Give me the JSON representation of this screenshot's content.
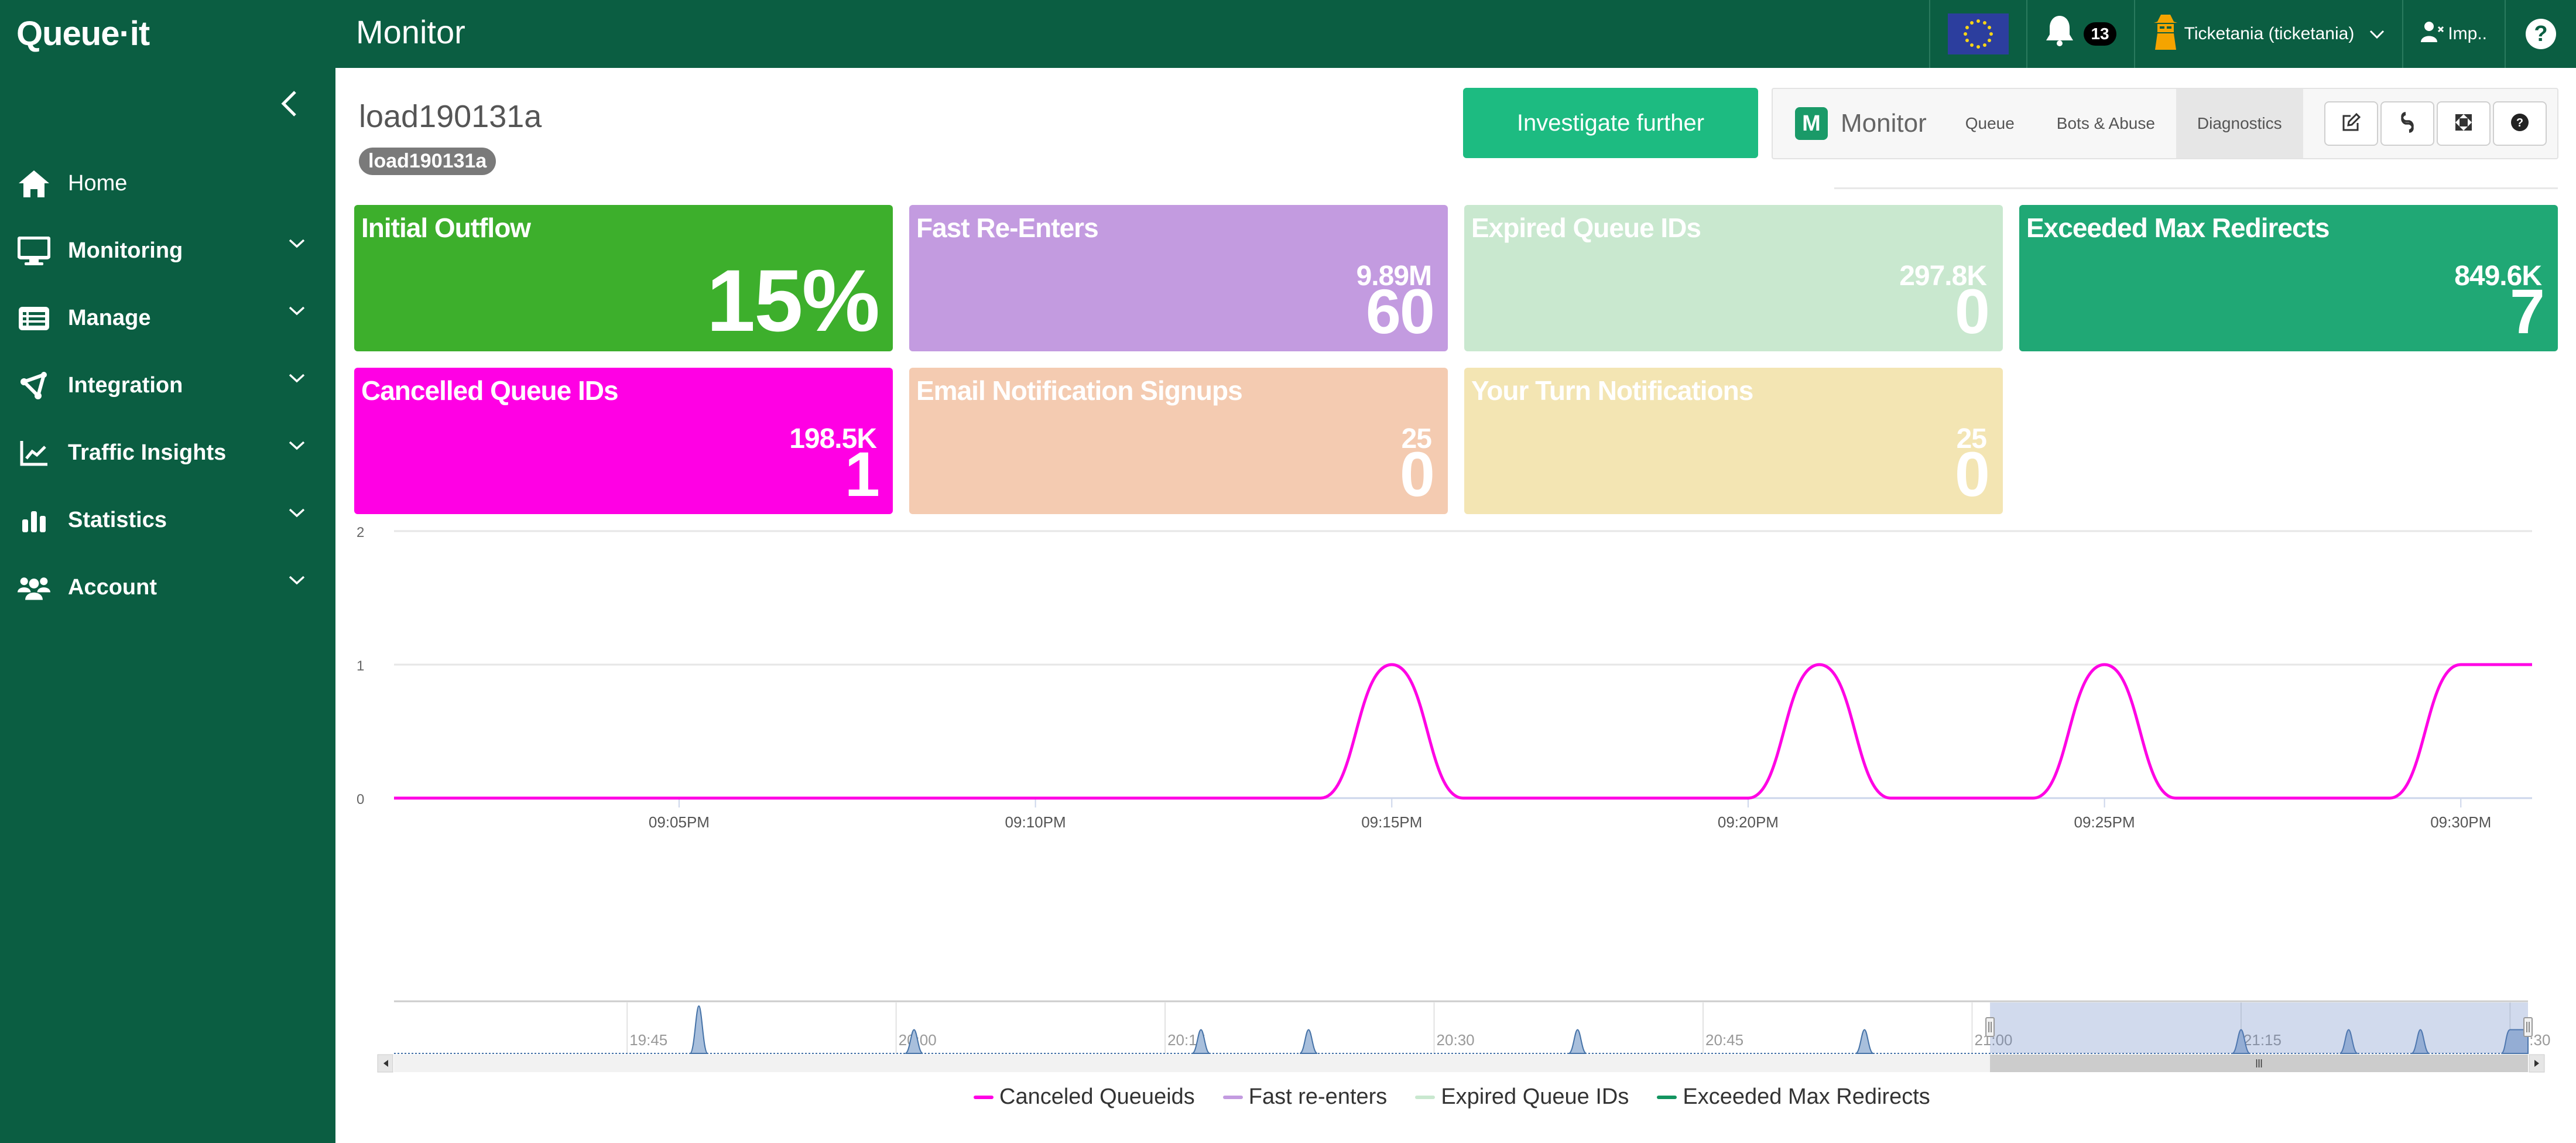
{
  "header": {
    "logo": "Queue·it",
    "title": "Monitor",
    "notifications_count": "13",
    "account_label": "Ticketania (ticketania)",
    "impersonate_label": "Imp..",
    "help_label": "?"
  },
  "sidebar": {
    "items": [
      {
        "label": "Home",
        "icon": "home-icon",
        "expandable": false
      },
      {
        "label": "Monitoring",
        "icon": "monitor-icon",
        "expandable": true
      },
      {
        "label": "Manage",
        "icon": "list-icon",
        "expandable": true
      },
      {
        "label": "Integration",
        "icon": "integration-icon",
        "expandable": true
      },
      {
        "label": "Traffic Insights",
        "icon": "line-chart-icon",
        "expandable": true
      },
      {
        "label": "Statistics",
        "icon": "bar-chart-icon",
        "expandable": true
      },
      {
        "label": "Account",
        "icon": "users-icon",
        "expandable": true
      }
    ]
  },
  "page": {
    "title": "load190131a",
    "badge": "load190131a",
    "investigate_label": "Investigate further"
  },
  "toolbar": {
    "badge": "M",
    "monitor_label": "Monitor",
    "tabs": [
      {
        "label": "Queue",
        "active": false
      },
      {
        "label": "Bots & Abuse",
        "active": false
      },
      {
        "label": "Diagnostics",
        "active": true
      }
    ],
    "icons": [
      "edit-icon",
      "link-icon",
      "fullscreen-icon",
      "help-icon"
    ]
  },
  "tiles": [
    {
      "title": "Initial Outflow",
      "sub": "",
      "value": "15%",
      "color": "#3daf2c"
    },
    {
      "title": "Fast Re-Enters",
      "sub": "9.89M",
      "value": "60",
      "color": "#c39be0"
    },
    {
      "title": "Expired Queue IDs",
      "sub": "297.8K",
      "value": "0",
      "color": "#c9e8cf"
    },
    {
      "title": "Exceeded Max Redirects",
      "sub": "849.6K",
      "value": "7",
      "color": "#20a875"
    },
    {
      "title": "Cancelled Queue IDs",
      "sub": "198.5K",
      "value": "1",
      "color": "#ff00e4"
    },
    {
      "title": "Email Notification Signups",
      "sub": "25",
      "value": "0",
      "color": "#f4cbb1"
    },
    {
      "title": "Your Turn Notifications",
      "sub": "25",
      "value": "0",
      "color": "#f3e5b3"
    }
  ],
  "chart_data": {
    "type": "line",
    "title": "",
    "xlabel": "",
    "ylabel": "",
    "ylim": [
      0,
      2
    ],
    "yticks": [
      "0",
      "1",
      "2"
    ],
    "grid": true,
    "x": [
      "09:01PM",
      "09:02PM",
      "09:03PM",
      "09:04PM",
      "09:05PM",
      "09:06PM",
      "09:07PM",
      "09:08PM",
      "09:09PM",
      "09:10PM",
      "09:11PM",
      "09:12PM",
      "09:13PM",
      "09:14PM",
      "09:15PM",
      "09:16PM",
      "09:17PM",
      "09:18PM",
      "09:19PM",
      "09:20PM",
      "09:21PM",
      "09:22PM",
      "09:23PM",
      "09:24PM",
      "09:25PM",
      "09:26PM",
      "09:27PM",
      "09:28PM",
      "09:29PM",
      "09:30PM",
      "09:31PM"
    ],
    "xticks": [
      "09:05PM",
      "09:10PM",
      "09:15PM",
      "09:20PM",
      "09:25PM",
      "09:30PM"
    ],
    "series": [
      {
        "name": "Canceled Queueids",
        "color": "#ff00e4",
        "values": [
          0,
          0,
          0,
          0,
          0,
          0,
          0,
          0,
          0,
          0,
          0,
          0,
          0,
          0,
          1,
          0,
          0,
          0,
          0,
          0,
          1,
          0,
          0,
          0,
          1,
          0,
          0,
          0,
          0,
          1,
          1
        ]
      },
      {
        "name": "Fast re-enters",
        "color": "#c39be0",
        "values": []
      },
      {
        "name": "Expired Queue IDs",
        "color": "#c9e8cf",
        "values": []
      },
      {
        "name": "Exceeded Max Redirects",
        "color": "#139460",
        "values": []
      }
    ],
    "legend_position": "bottom-center",
    "navigator": {
      "x_start": "19:32",
      "x_end": "21:31",
      "ticks": [
        "19:45",
        "20:00",
        "20:15",
        "20:30",
        "20:45",
        "21:00",
        "21:15",
        "21:30"
      ],
      "peaks": [
        {
          "time": "19:49",
          "value": 2
        },
        {
          "time": "20:01",
          "value": 1
        },
        {
          "time": "20:17",
          "value": 1
        },
        {
          "time": "20:23",
          "value": 1
        },
        {
          "time": "20:38",
          "value": 1
        },
        {
          "time": "20:54",
          "value": 1
        },
        {
          "time": "21:15",
          "value": 1
        },
        {
          "time": "21:21",
          "value": 1
        },
        {
          "time": "21:25",
          "value": 1
        },
        {
          "time": "21:30",
          "value": 1
        },
        {
          "time": "21:31",
          "value": 1
        }
      ],
      "selection": [
        "21:01",
        "21:31"
      ]
    }
  }
}
